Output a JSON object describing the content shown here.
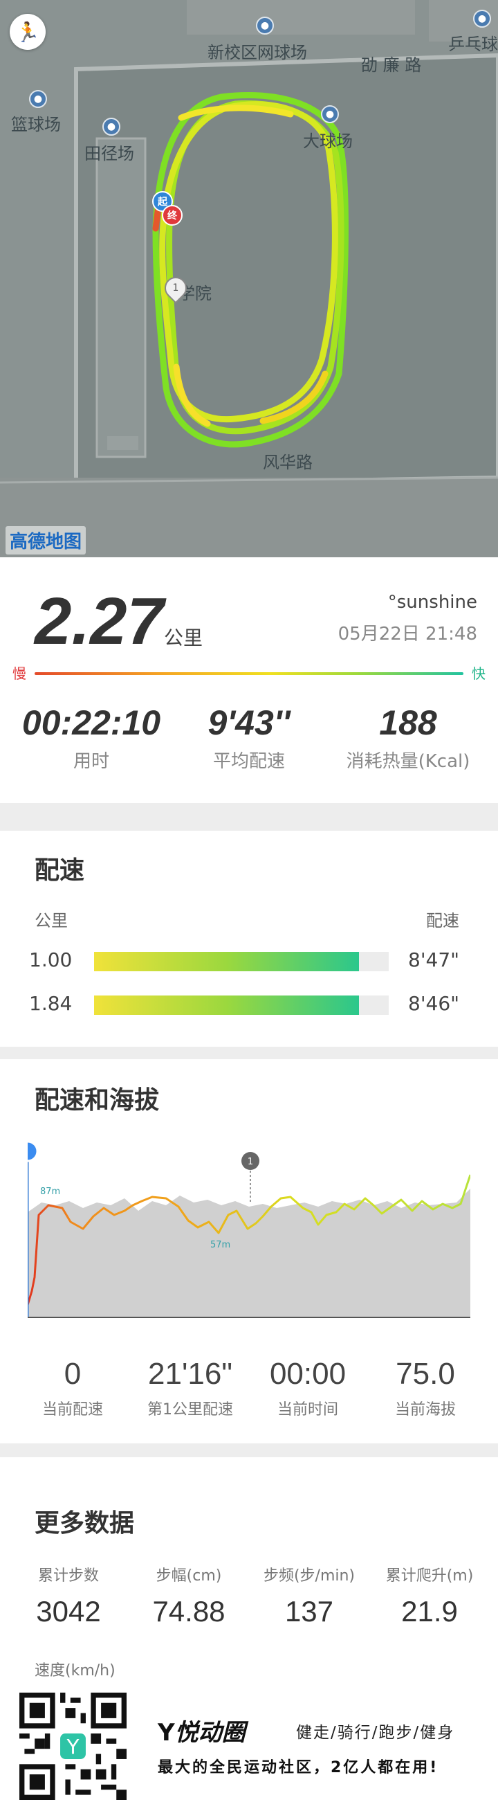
{
  "map": {
    "labels": [
      "新校区网球场",
      "劭 廉 路",
      "乒乓球",
      "篮球场",
      "田径场",
      "学院",
      "风华路",
      "大球场"
    ],
    "attribution": "高德地图",
    "start_marker": "起",
    "end_marker": "终",
    "km_marker": "1"
  },
  "summary": {
    "distance": "2.27",
    "distance_unit": "公里",
    "username": "°sunshine",
    "datetime": "05月22日 21:48",
    "speed_slow": "慢",
    "speed_fast": "快",
    "stats": [
      {
        "value": "00:22:10",
        "label": "用时"
      },
      {
        "value": "9'43''",
        "label": "平均配速"
      },
      {
        "value": "188",
        "label": "消耗热量(Kcal)"
      }
    ]
  },
  "pace": {
    "title": "配速",
    "col_km": "公里",
    "col_pace": "配速",
    "rows": [
      {
        "km": "1.00",
        "pace": "8'47\"",
        "fraction": 0.9
      },
      {
        "km": "1.84",
        "pace": "8'46\"",
        "fraction": 0.9
      }
    ]
  },
  "altitude": {
    "title": "配速和海拔",
    "max_label": "87m",
    "min_label": "57m",
    "km_marker": "1",
    "stats": [
      {
        "value": "0",
        "label": "当前配速"
      },
      {
        "value": "21'16\"",
        "label": "第1公里配速"
      },
      {
        "value": "00:00",
        "label": "当前时间"
      },
      {
        "value": "75.0",
        "label": "当前海拔"
      }
    ]
  },
  "more": {
    "title": "更多数据",
    "items": [
      {
        "label": "累计步数",
        "value": "3042"
      },
      {
        "label": "步幅(cm)",
        "value": "74.88"
      },
      {
        "label": "步频(步/min)",
        "value": "137"
      },
      {
        "label": "累计爬升(m)",
        "value": "21.9"
      }
    ],
    "speed_label": "速度(km/h)"
  },
  "footer": {
    "brand": "悦动圈",
    "tagline": "健走/骑行/跑步/健身",
    "slogan": "最大的全民运动社区，2亿人都在用!"
  }
}
